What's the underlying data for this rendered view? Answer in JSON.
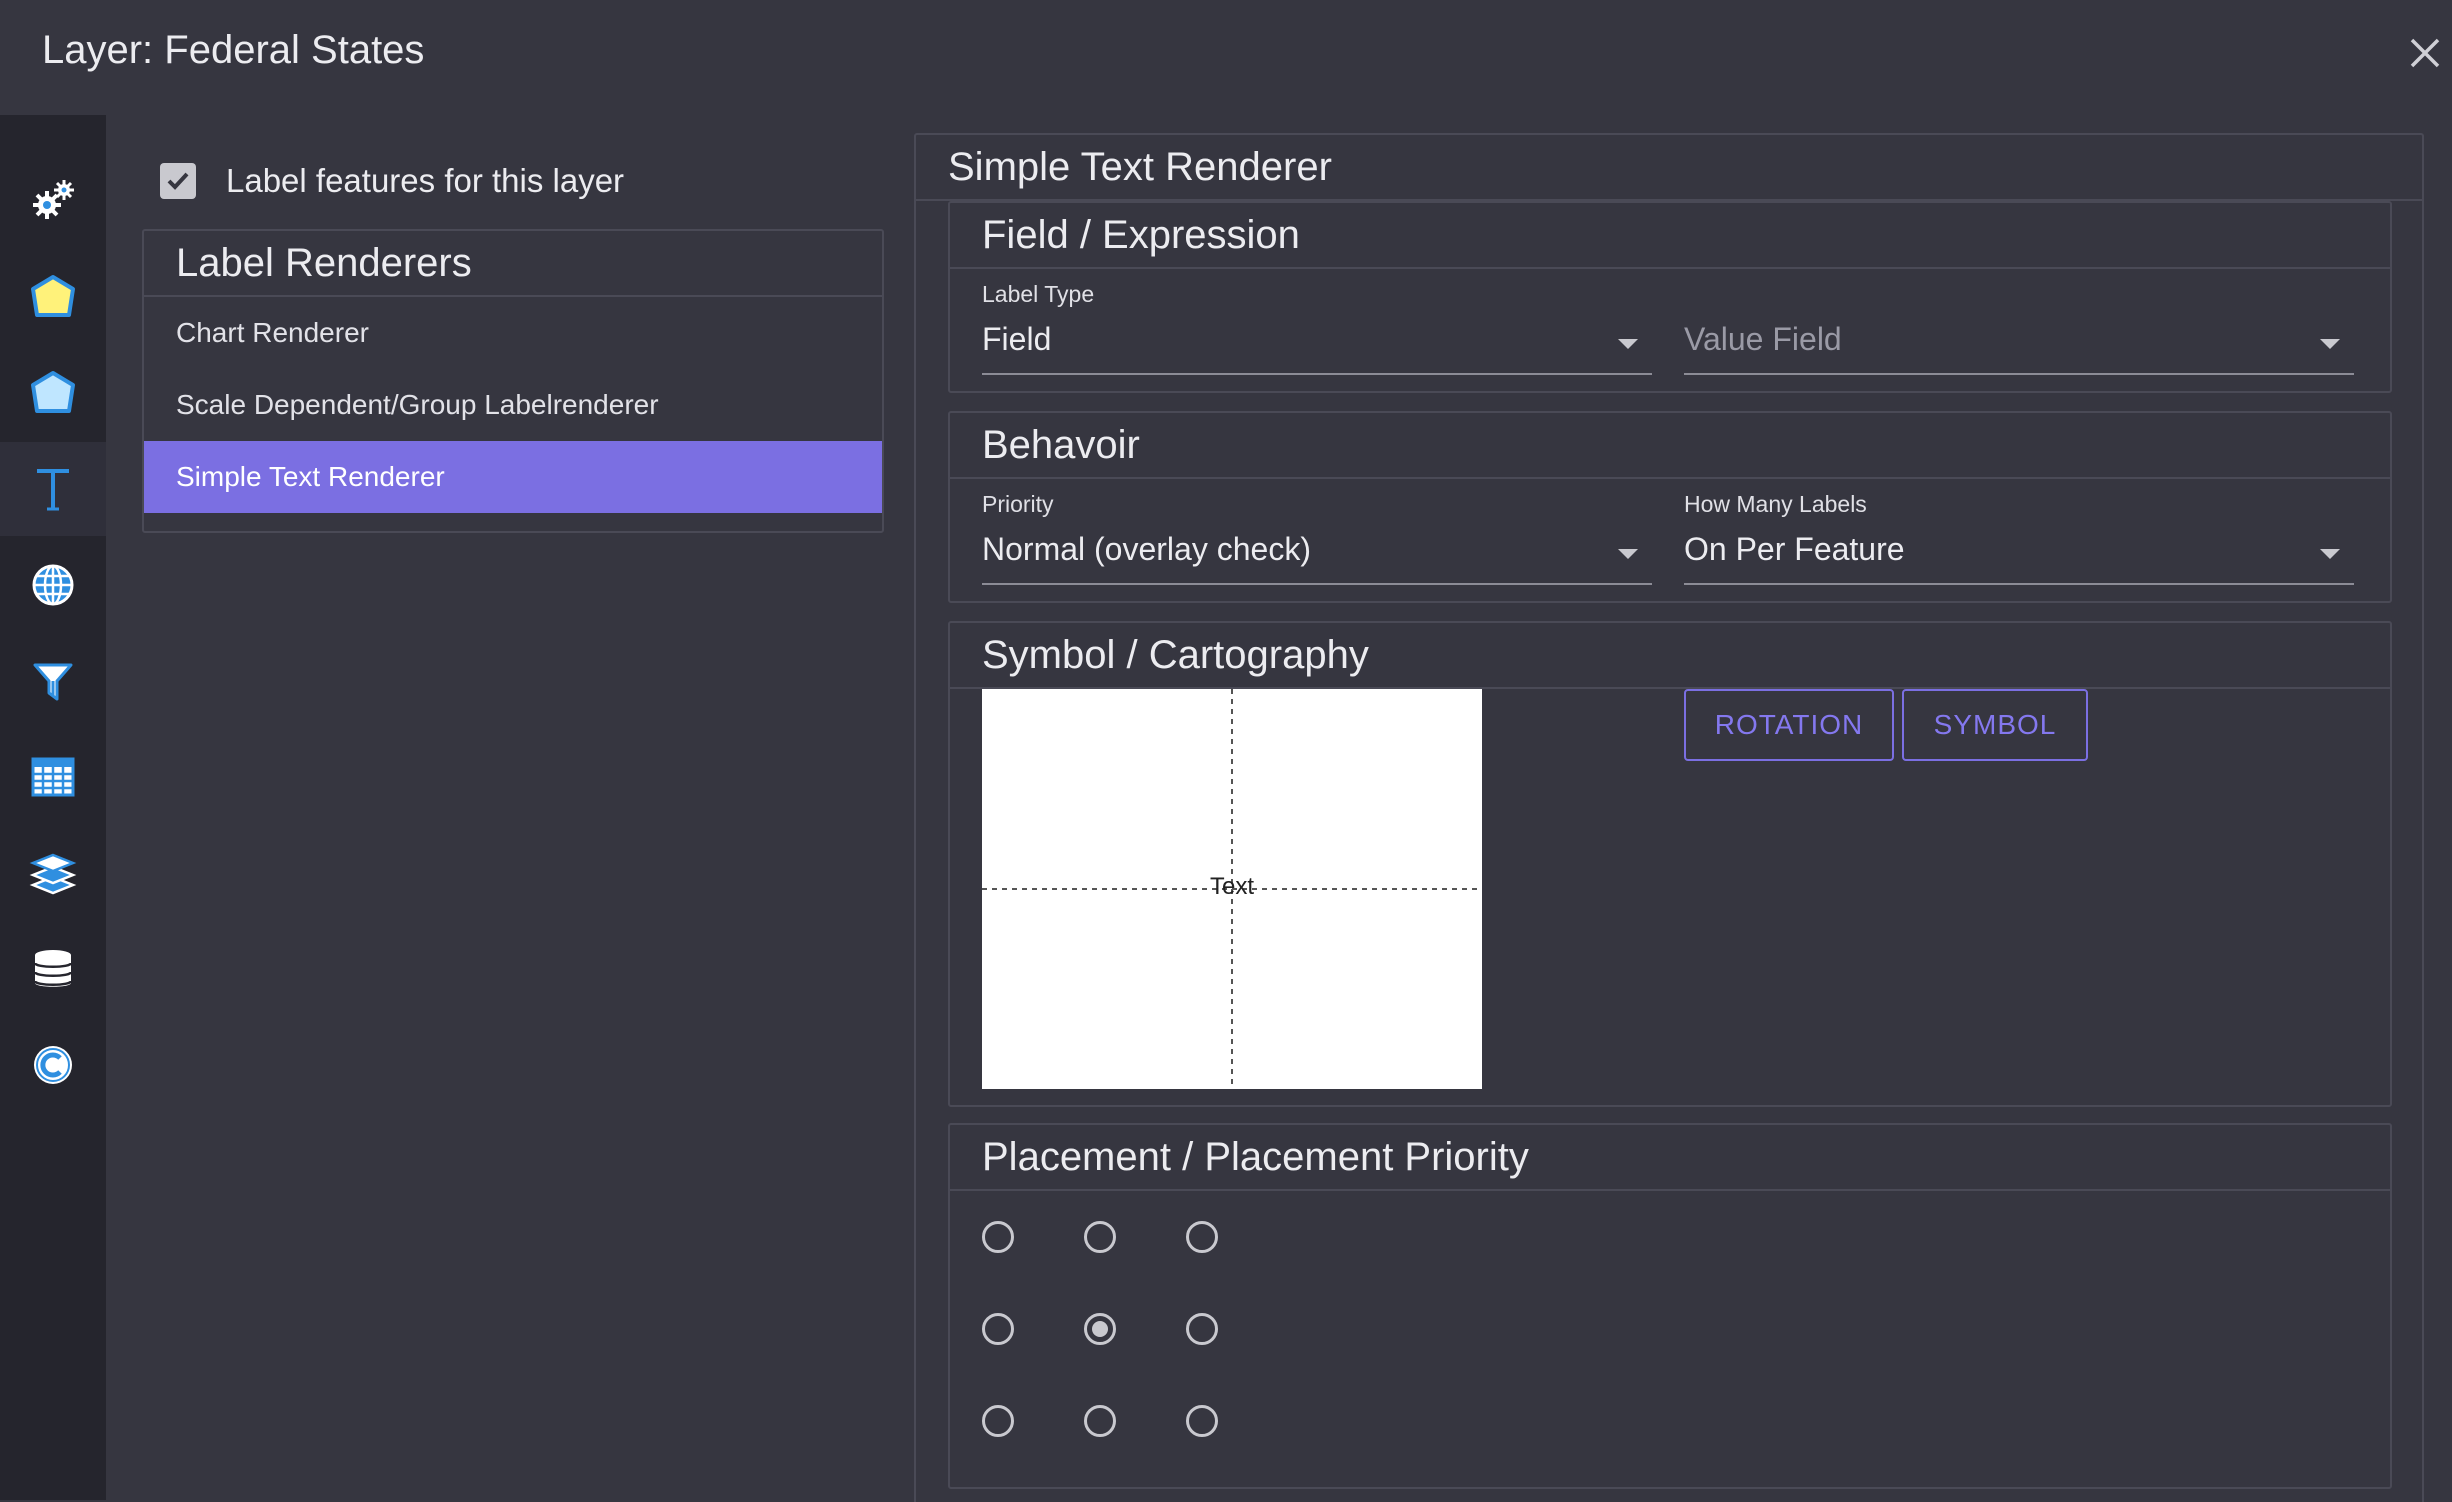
{
  "window": {
    "title": "Layer: Federal States"
  },
  "sidebar": {
    "items": [
      {
        "icon": "gears-icon"
      },
      {
        "icon": "polygon-yellow-icon"
      },
      {
        "icon": "polygon-blue-icon"
      },
      {
        "icon": "text-t-icon",
        "active": true
      },
      {
        "icon": "globe-icon"
      },
      {
        "icon": "filter-icon"
      },
      {
        "icon": "table-icon"
      },
      {
        "icon": "layers-icon"
      },
      {
        "icon": "database-icon"
      },
      {
        "icon": "copyright-icon"
      }
    ]
  },
  "label_features": {
    "label": "Label features for this layer",
    "checked": true
  },
  "renderers": {
    "title": "Label Renderers",
    "items": [
      "Chart Renderer",
      "Scale Dependent/Group Labelrenderer",
      "Simple Text Renderer"
    ],
    "selected_index": 2
  },
  "main": {
    "title": "Simple Text Renderer",
    "field_expression": {
      "title": "Field / Expression",
      "label_type_label": "Label Type",
      "label_type_value": "Field",
      "value_field_placeholder": "Value Field"
    },
    "behavior": {
      "title": "Behavoir",
      "priority_label": "Priority",
      "priority_value": "Normal (overlay check)",
      "how_many_label": "How Many Labels",
      "how_many_value": "On Per Feature"
    },
    "symbol": {
      "title": "Symbol / Cartography",
      "preview_text": "Text",
      "rotation_button": "ROTATION",
      "symbol_button": "SYMBOL"
    },
    "placement": {
      "title": "Placement / Placement Priority",
      "selected": [
        1,
        1
      ]
    }
  },
  "colors": {
    "accent": "#7b6fe2",
    "background": "#363640",
    "sidebar": "#25252d",
    "icon_blue": "#2f8fe0"
  }
}
